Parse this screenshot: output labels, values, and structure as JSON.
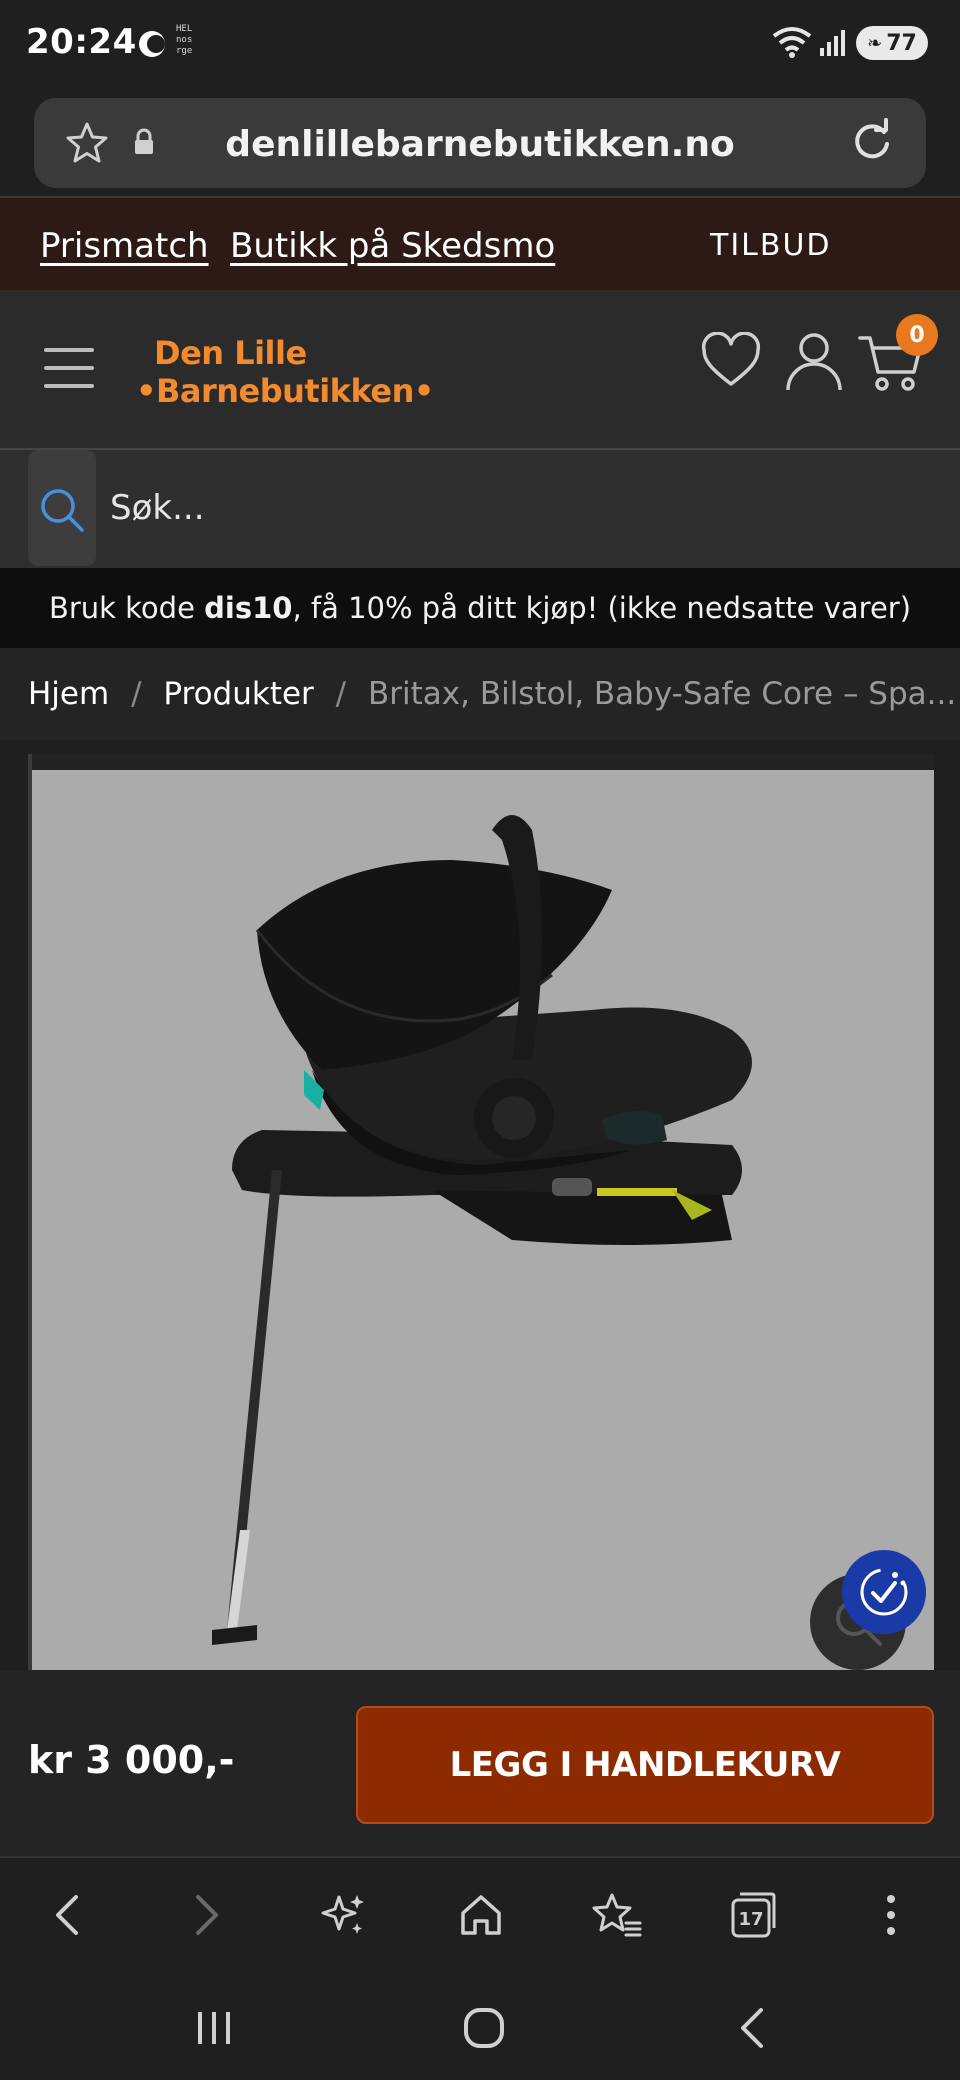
{
  "status_bar": {
    "time": "20:24",
    "tiny_text": "HEL\nnos\nrge",
    "battery": "77"
  },
  "url_bar": {
    "url": "denlillebarnebutikken.no"
  },
  "promo": {
    "link1": "Prismatch",
    "link2": "Butikk på Skedsmo",
    "offers": "TILBUD"
  },
  "header": {
    "logo_line1": "Den Lille",
    "logo_line2": "•Barnebutikken•",
    "cart_count": "0"
  },
  "search": {
    "placeholder": "Søk..."
  },
  "code_banner": {
    "prefix": "Bruk kode",
    "code": "dis10",
    "suffix": ", få 10% på ditt kjøp! (ikke nedsatte varer)"
  },
  "breadcrumb": {
    "home": "Hjem",
    "products": "Produkter",
    "current": "Britax, Bilstol, Baby-Safe Core – Spa...",
    "separator": "/"
  },
  "product": {
    "image_alt": "Britax Baby-Safe Core bilstol med base"
  },
  "buy_bar": {
    "price": "kr 3 000,-",
    "button_label": "LEGG I HANDLEKURV"
  },
  "browser_nav": {
    "tabs_count": "17"
  },
  "colors": {
    "accent_orange": "#f28a2e",
    "button_red": "#8e2a00",
    "promo_bg": "#2d1a15",
    "accessibility_blue": "#1a3aa8"
  }
}
